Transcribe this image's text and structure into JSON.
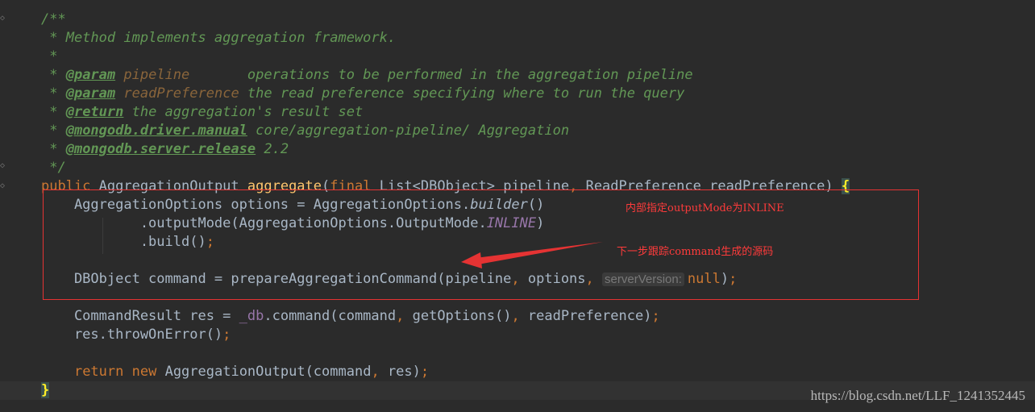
{
  "code": {
    "doc_open": "/**",
    "doc_desc": " * Method implements aggregation framework.",
    "doc_blank": " *",
    "doc_star": " * ",
    "doc_close": " */",
    "param_tag": "@param",
    "return_tag": "@return",
    "manual_tag": "@mongodb.driver.manual",
    "release_tag": "@mongodb.server.release",
    "param1_name": "pipeline",
    "param1_desc": "       operations to be performed in the aggregation pipeline",
    "param2_name": "readPreference",
    "param2_desc": " the read preference specifying where to run the query",
    "return_desc": " the aggregation's result set",
    "manual_desc": " core/aggregation-pipeline/ Aggregation",
    "release_desc": " 2.2",
    "sig_public": "public",
    "sig_type": " AggregationOutput ",
    "sig_name": "aggregate",
    "sig_open": "(",
    "sig_final": "final",
    "sig_p1": " List<DBObject> pipeline",
    "sig_comma": ",",
    "sig_p2": " ReadPreference readPreference) ",
    "sig_brace": "{",
    "l1_a": "    AggregationOptions options = AggregationOptions.",
    "l1_b": "builder",
    "l1_c": "()",
    "l2_a": "            .outputMode(AggregationOptions.OutputMode.",
    "l2_b": "INLINE",
    "l2_c": ")",
    "l3_a": "            .build()",
    "semi": ";",
    "l4_a": "    DBObject command = prepareAggregationCommand(pipeline",
    "l4_b": " options",
    "l4_hint": "serverVersion:",
    "l4_null": "null",
    "l4_close": ")",
    "l5_a": "    CommandResult res = ",
    "l5_field": "_db",
    "l5_b": ".command(command",
    "l5_c": " getOptions()",
    "l5_d": " readPreference)",
    "l6_a": "    res.throwOnError()",
    "l7_return": "return",
    "l7_new": "new",
    "l7_b": " AggregationOutput(command",
    "l7_c": " res)",
    "close_brace": "}"
  },
  "annotations": {
    "note1": "内部指定outputMode为INLINE",
    "note2": "下一步跟踪command生成的源码"
  },
  "watermark": "https://blog.csdn.net/LLF_1241352445",
  "colors": {
    "background": "#2b2b2b",
    "annotation_red": "#e53333",
    "doc_comment": "#629755",
    "keyword": "#cc7832",
    "method": "#ffc66d"
  }
}
